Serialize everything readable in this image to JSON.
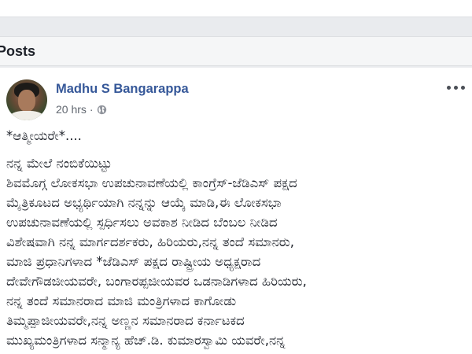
{
  "section": {
    "title": "Posts"
  },
  "post": {
    "author": "Madhu S Bangarappa",
    "time": "20 hrs",
    "separator": "·",
    "icons": {
      "avatar": "profile-photo",
      "privacy": "globe-icon",
      "menu": "more-options-icon"
    },
    "greeting": "*ಆತ್ಮೀಯರೇ*....",
    "lines": [
      "ನನ್ನ ಮೇಲೆ ನಂಬಿಕೆಯಿಟ್ಟು",
      "ಶಿವಮೊಗ್ಗ ಲೋಕಸಭಾ ಉಪಚುನಾವಣೆಯಲ್ಲಿ ಕಾಂಗ್ರೆಸ್-ಜೆಡಿಎಸ್ ಪಕ್ಷದ",
      "ಮೈತ್ರಿಕೂಟದ ಅಭ್ಯರ್ಥಿಯಾಗಿ ನನ್ನನ್ನು ಆಯ್ಕೆ ಮಾಡಿ,ಈ ಲೋಕಸಭಾ",
      "ಉಪಚುನಾವಣೆಯಲ್ಲಿ ಸ್ಪರ್ಧಿಸಲು ಅವಕಾಶ ನೀಡಿದ ಬೆಂಬಲ ನೀಡಿದ",
      "ವಿಶೇಷವಾಗಿ ನನ್ನ ಮಾರ್ಗದರ್ಶಕರು, ಹಿರಿಯರು,ನನ್ನ ತಂದೆ ಸಮಾನರು,",
      "ಮಾಜಿ ಪ್ರಧಾನಿಗಳಾದ *ಜೆಡಿಎಸ್ ಪಕ್ಷದ ರಾಷ್ಟ್ರೀಯ ಅಧ್ಯಕ್ಷರಾದ",
      "ದೇವೇಗೌಡಜೀಯವರೇ, ಬಂಗಾರಪ್ಪಜೀಯವರ ಒಡನಾಡಿಗಳಾದ ಹಿರಿಯರು,",
      "ನನ್ನ ತಂದೆ ಸಮಾನರಾದ ಮಾಜಿ ಮಂತ್ರಿಗಳಾದ ಕಾಗೋಡು",
      "ತಿಮ್ಮಪ್ಪಾಜೀಯವರೇ,ನನ್ನ ಅಣ್ಣನ ಸಮಾನರಾದ ಕರ್ನಾಟಕದ",
      "ಮುಖ್ಯಮಂತ್ರಿಗಳಾದ ಸನ್ಮಾನ್ಯ ಹೆಚ್.ಡಿ. ಕುಮಾರಸ್ವಾಮಿ ಯವರೇ,ನನ್ನ"
    ]
  }
}
